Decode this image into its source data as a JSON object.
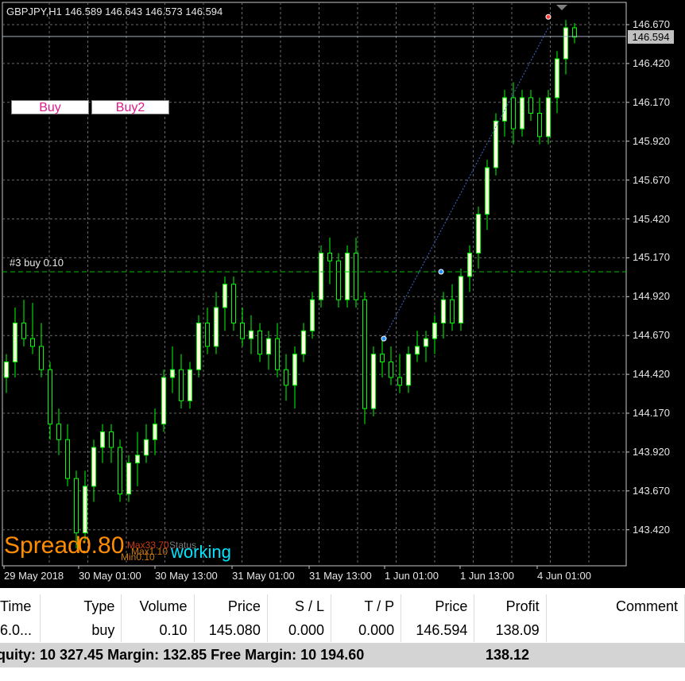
{
  "chart": {
    "symbol_info": "GBPJPY,H1  146.589 146.643 146.573 146.594",
    "order_label": "#3 buy 0.10",
    "buttons": [
      "Buy",
      "Buy2"
    ],
    "spread_label": "Spread:",
    "spread_value": "0.80",
    "status_max": "Max33.70",
    "status_label": "Status",
    "status_min": "Min0.10",
    "status_min2": "Max1.10",
    "working": "working",
    "current_price": "146.594",
    "price_axis": [
      "146.670",
      "146.420",
      "146.170",
      "145.920",
      "145.670",
      "145.420",
      "145.170",
      "144.920",
      "144.670",
      "144.420",
      "144.170",
      "143.920",
      "143.670",
      "143.420"
    ],
    "time_axis": [
      "29 May 2018",
      "30 May 01:00",
      "30 May 13:00",
      "31 May 01:00",
      "31 May 13:00",
      "1 Jun 01:00",
      "1 Jun 13:00",
      "4 Jun 01:00"
    ],
    "colors": {
      "bull": "#ffffe0",
      "bear": "#000000",
      "wick": "#00ff00",
      "grid": "#6a6a6a",
      "order_line": "#00c000"
    }
  },
  "terminal": {
    "headers": [
      "Time",
      "Type",
      "Volume",
      "Price",
      "S / L",
      "T / P",
      "Price",
      "Profit",
      "Comment"
    ],
    "row": [
      "6.0...",
      "buy",
      "0.10",
      "145.080",
      "0.000",
      "0.000",
      "146.594",
      "138.09",
      ""
    ],
    "summary": "quity: 10 327.45  Margin: 132.85  Free Margin: 10 194.60",
    "summary_profit": "138.12"
  }
}
